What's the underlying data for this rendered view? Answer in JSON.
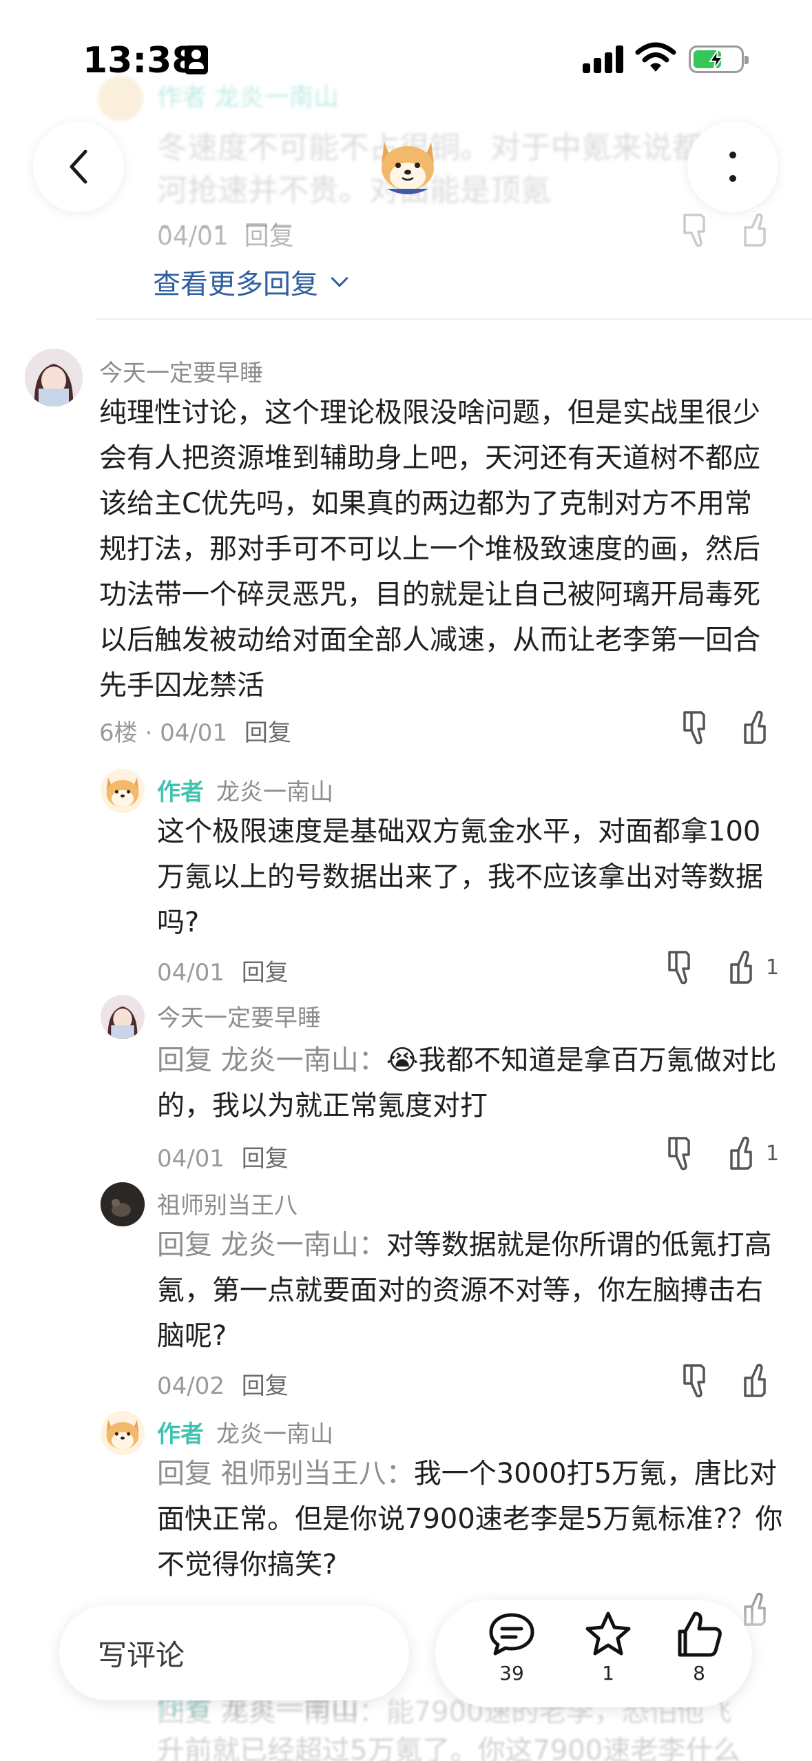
{
  "status_bar": {
    "time": "13:38"
  },
  "header": {
    "back_icon": "chevron-left-icon",
    "more_icon": "vertical-ellipsis-icon",
    "avatar_icon": "shiba-dog-avatar"
  },
  "faded_top": {
    "line1": "作者 龙炎一南山",
    "line2": "冬速度不可能不占很铜。对于中氪来说都",
    "line3": "河抢速并不贵。对面能是顶氪",
    "meta_date": "04/01",
    "meta_reply": "回复"
  },
  "more_replies": {
    "label": "查看更多回复"
  },
  "main_comment": {
    "username": "今天一定要早睡",
    "text": "纯理性讨论，这个理论极限没啥问题，但是实战里很少会有人把资源堆到辅助身上吧，天河还有天道树不都应该给主C优先吗，如果真的两边都为了克制对方不用常规打法，那对手可不可以上一个堆极致速度的画，然后功法带一个碎灵恶咒，目的就是让自己被阿璃开局毒死以后触发被动给对面全部人减速，从而让老李第一回合先手囚龙禁活",
    "floor": "6楼",
    "date": "04/01",
    "reply_label": "回复"
  },
  "replies": [
    {
      "author_tag": "作者",
      "username": "龙炎一南山",
      "prefix": "",
      "text": "这个极限速度是基础双方氪金水平，对面都拿100万氪以上的号数据出来了，我不应该拿出对等数据吗?",
      "date": "04/01",
      "reply_label": "回复",
      "likes": "1"
    },
    {
      "author_tag": "",
      "username": "今天一定要早睡",
      "prefix": "回复 龙炎一南山：",
      "emoji": "😭",
      "text": "我都不知道是拿百万氪做对比的，我以为就正常氪度对打",
      "date": "04/01",
      "reply_label": "回复",
      "likes": "1"
    },
    {
      "author_tag": "",
      "username": "祖师别当王八",
      "prefix": "回复 龙炎一南山：",
      "text": "对等数据就是你所谓的低氪打高氪，第一点就要面对的资源不对等，你左脑搏击右脑呢?",
      "date": "04/02",
      "reply_label": "回复",
      "likes": ""
    },
    {
      "author_tag": "作者",
      "username": "龙炎一南山",
      "prefix": "回复 祖师别当王八：",
      "text": "我一个3000打5万氪，唐比对面快正常。但是你说7900速老李是5万氪标准?？你不觉得你搞笑?",
      "date": "04/02",
      "reply_label": "回复",
      "likes": ""
    }
  ],
  "faded_bottom": {
    "author_tag": "作者",
    "username": "龙炎一南山",
    "line1": "回复 龙炎一南山：能7900速的老李，恐怕他飞",
    "line2": "升前就已经超过5万氪了。你这7900速老李什么"
  },
  "bottom_bar": {
    "write_placeholder": "写评论",
    "comment_count": "39",
    "favorite_count": "1",
    "like_count": "8",
    "comment_icon": "speech-bubble-icon",
    "favorite_icon": "star-icon",
    "like_icon": "thumbs-up-icon"
  },
  "colors": {
    "author_tag": "#3fc3b1",
    "link_blue": "#2f5f9f",
    "battery_green": "#35c759"
  }
}
